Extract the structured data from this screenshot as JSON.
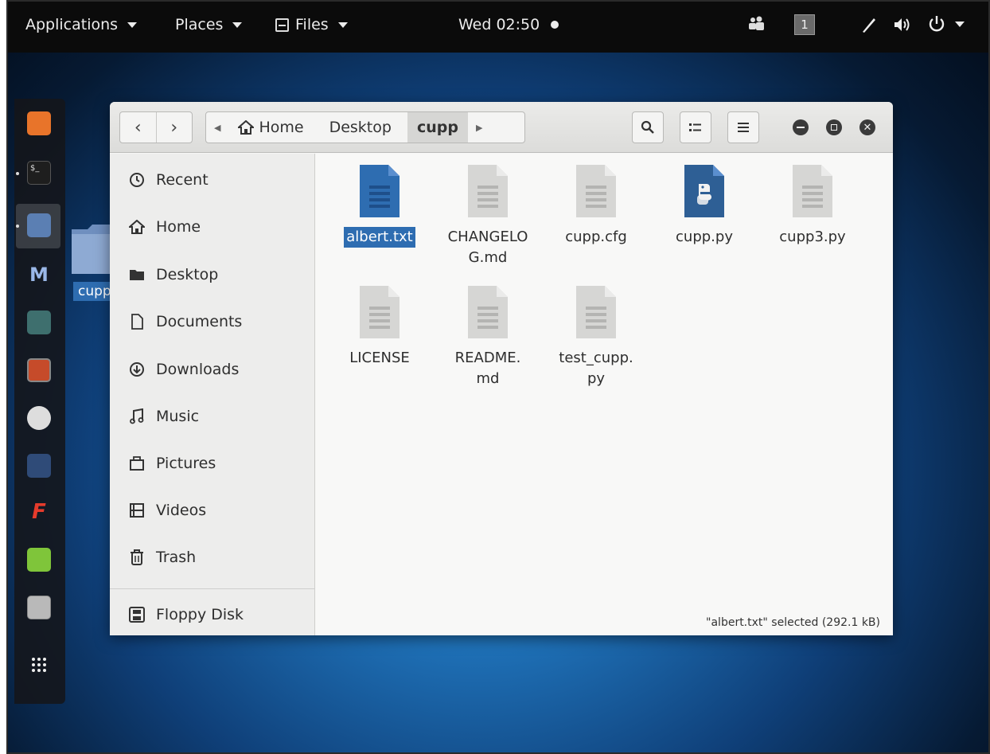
{
  "topbar": {
    "applications": "Applications",
    "places": "Places",
    "files": "Files",
    "clock": "Wed 02:50",
    "workspace": "1"
  },
  "desktop": {
    "folder_label": "cupp"
  },
  "window": {
    "path": {
      "home": "Home",
      "desktop": "Desktop",
      "current": "cupp"
    },
    "sidebar": [
      {
        "label": "Recent",
        "icon": "clock-icon"
      },
      {
        "label": "Home",
        "icon": "home-icon"
      },
      {
        "label": "Desktop",
        "icon": "desktop-folder-icon"
      },
      {
        "label": "Documents",
        "icon": "document-icon"
      },
      {
        "label": "Downloads",
        "icon": "download-icon"
      },
      {
        "label": "Music",
        "icon": "music-icon"
      },
      {
        "label": "Pictures",
        "icon": "camera-icon"
      },
      {
        "label": "Videos",
        "icon": "film-icon"
      },
      {
        "label": "Trash",
        "icon": "trash-icon"
      },
      {
        "label": "Floppy Disk",
        "icon": "floppy-icon"
      }
    ],
    "files": [
      {
        "name": "albert.txt",
        "type": "text-selected"
      },
      {
        "name": "CHANGELO G.md",
        "line1": "CHANGELO",
        "line2": "G.md",
        "type": "generic"
      },
      {
        "name": "cupp.cfg",
        "type": "generic"
      },
      {
        "name": "cupp.py",
        "type": "python"
      },
      {
        "name": "cupp3.py",
        "type": "generic"
      },
      {
        "name": "LICENSE",
        "type": "generic"
      },
      {
        "name": "README. md",
        "line1": "README.",
        "line2": "md",
        "type": "generic"
      },
      {
        "name": "test_cupp. py",
        "line1": "test_cupp.",
        "line2": "py",
        "type": "generic"
      }
    ],
    "status": "\"albert.txt\" selected  (292.1 kB)"
  },
  "colors": {
    "selection": "#2e6db1",
    "topbar": "#0b0b0b"
  }
}
